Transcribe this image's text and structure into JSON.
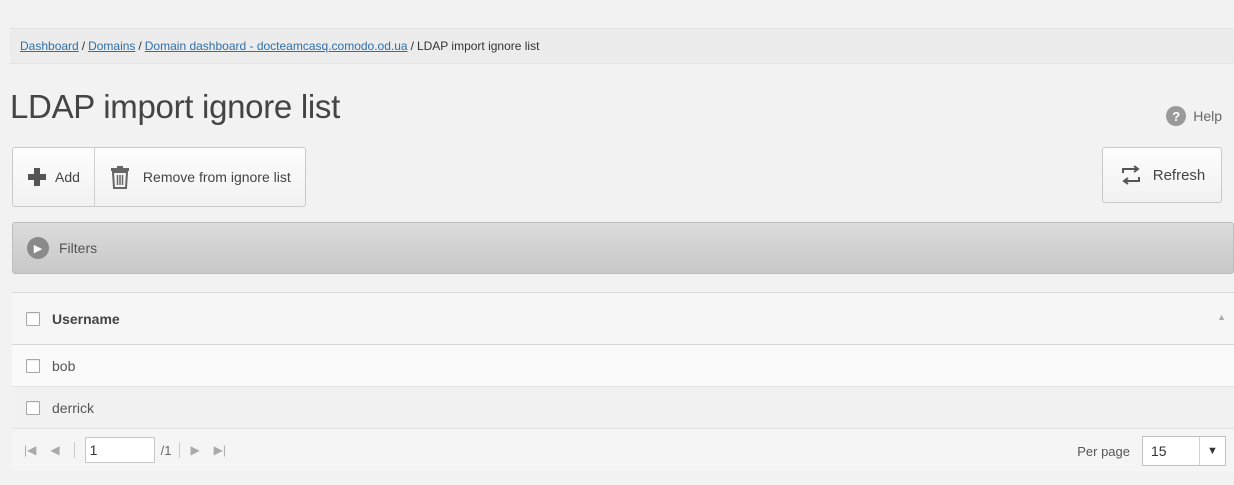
{
  "breadcrumb": {
    "items": [
      {
        "label": "Dashboard",
        "link": true
      },
      {
        "label": "Domains",
        "link": true
      },
      {
        "label": "Domain dashboard - docteamcasq.comodo.od.ua",
        "link": true
      },
      {
        "label": "LDAP import ignore list",
        "link": false
      }
    ],
    "separator": "/"
  },
  "page": {
    "title": "LDAP import ignore list",
    "help_label": "Help",
    "help_icon_glyph": "?"
  },
  "toolbar": {
    "add_label": "Add",
    "remove_label": "Remove from ignore list",
    "refresh_label": "Refresh"
  },
  "filters": {
    "label": "Filters",
    "icon_glyph": "▶"
  },
  "table": {
    "header": "Username",
    "rows": [
      {
        "username": "bob"
      },
      {
        "username": "derrick"
      }
    ]
  },
  "pagination": {
    "first_glyph": "|◀",
    "prev_glyph": "◀",
    "next_glyph": "▶",
    "last_glyph": "▶|",
    "current_page": "1",
    "total": "/1",
    "per_page_label": "Per page",
    "per_page_value": "15"
  },
  "colors": {
    "link": "#2f6fa8",
    "background": "#f2f2f2"
  }
}
